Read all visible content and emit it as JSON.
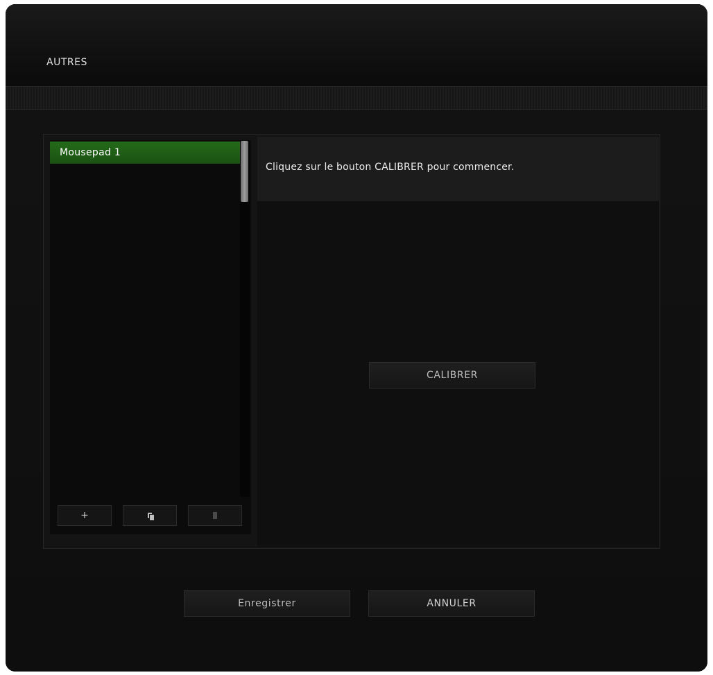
{
  "header": {
    "title": "AUTRES"
  },
  "profiles": {
    "items": [
      {
        "label": "Mousepad 1",
        "selected": true
      }
    ],
    "add_label": "+",
    "copy_icon": "copy-icon",
    "delete_icon": "trash-icon"
  },
  "calibration": {
    "instruction": "Cliquez sur le bouton CALIBRER pour commencer.",
    "calibrate_label": "CALIBRER"
  },
  "footer": {
    "save_label": "Enregistrer",
    "cancel_label": "ANNULER"
  },
  "colors": {
    "accent_green": "#246a19",
    "background": "#0d0d0d"
  }
}
